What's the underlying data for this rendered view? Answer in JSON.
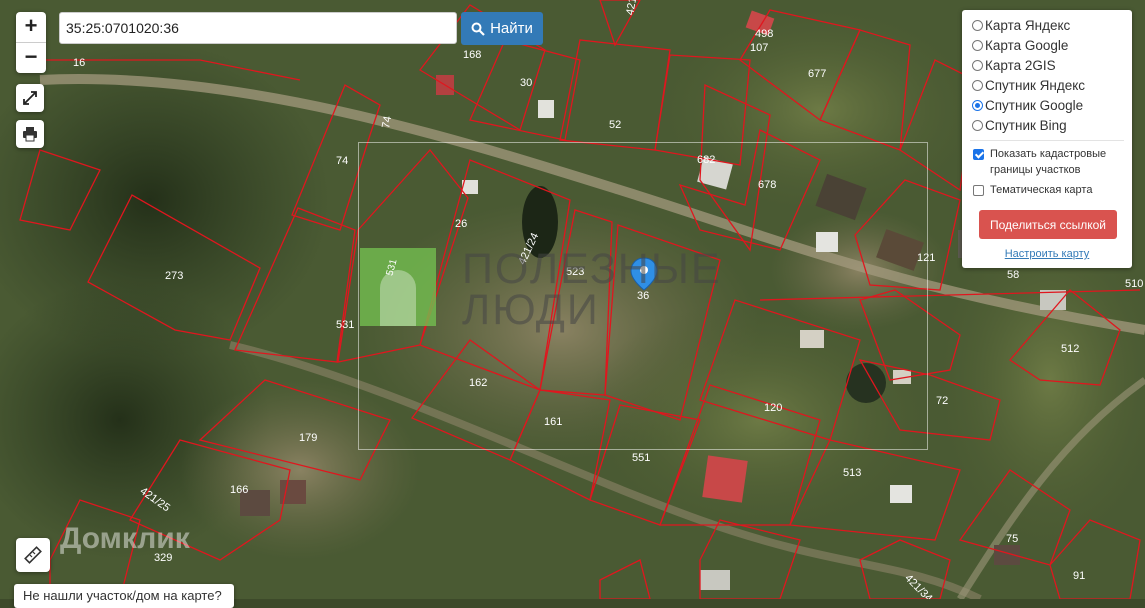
{
  "search": {
    "value": "35:25:0701020:36",
    "button_label": "Найти"
  },
  "zoom": {
    "in_label": "+",
    "out_label": "−"
  },
  "layers_panel": {
    "options": [
      {
        "label": "Карта Яндекс",
        "selected": false
      },
      {
        "label": "Карта Google",
        "selected": false
      },
      {
        "label": "Карта 2GIS",
        "selected": false
      },
      {
        "label": "Спутник Яндекс",
        "selected": false
      },
      {
        "label": "Спутник Google",
        "selected": true
      },
      {
        "label": "Спутник Bing",
        "selected": false
      }
    ],
    "show_borders_line1": "Показать кадастровые",
    "show_borders_line2": "границы участков",
    "show_borders_checked": true,
    "thematic_label": "Тематическая карта",
    "thematic_checked": false,
    "share_label": "Поделиться ссылкой",
    "configure_label": "Настроить карту"
  },
  "marker_label": "36",
  "watermark": {
    "line1": "ПОЛЕЗНЫЕ",
    "line2": "ЛЮДИ",
    "logo_text": "531"
  },
  "domclick_watermark": "Домклик",
  "bottom_message": "Не нашли участок/дом на карте?",
  "plot_labels": [
    "16",
    "168",
    "30",
    "52",
    "107",
    "498",
    "677",
    "421",
    "74",
    "74",
    "682",
    "678",
    "26",
    "421/24",
    "523",
    "36",
    "121",
    "58",
    "510",
    "273",
    "531",
    "512",
    "162",
    "120",
    "72",
    "179",
    "161",
    "551",
    "513",
    "166",
    "421/25",
    "329",
    "75",
    "91",
    "421/34"
  ],
  "colors": {
    "boundary": "#e0161e",
    "accent_blue": "#337ab7",
    "share_red": "#d9534f",
    "marker": "#2f8fe6"
  }
}
